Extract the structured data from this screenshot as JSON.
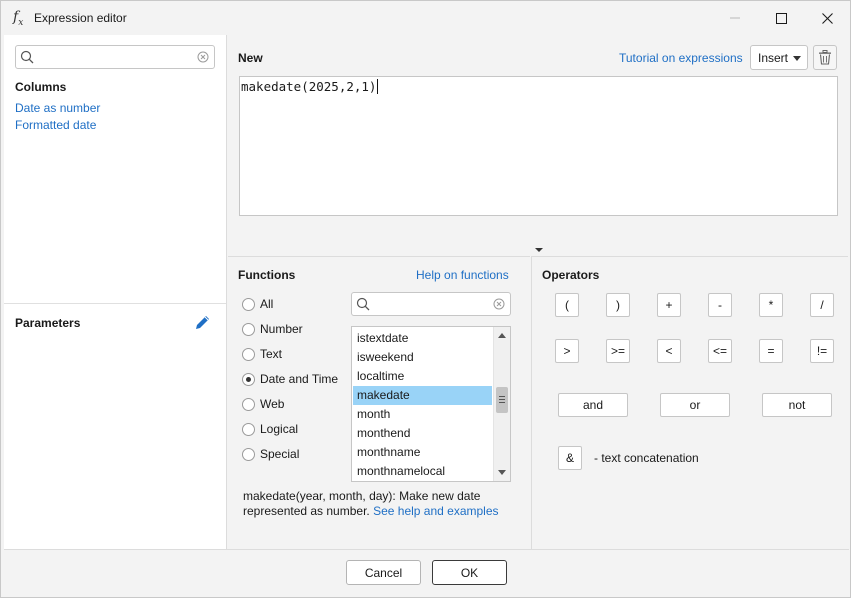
{
  "window": {
    "title": "Expression editor",
    "icon": "fx-function-icon"
  },
  "left": {
    "search": {
      "value": "",
      "placeholder": ""
    },
    "columns_heading": "Columns",
    "columns": [
      "Date as number",
      "Formatted date"
    ],
    "parameters_heading": "Parameters"
  },
  "editor": {
    "heading": "New",
    "tutorial_link": "Tutorial on expressions",
    "insert_label": "Insert",
    "expression": "makedate(2025,2,1)"
  },
  "functions": {
    "heading": "Functions",
    "help_link": "Help on functions",
    "search": {
      "value": "",
      "placeholder": ""
    },
    "categories": [
      "All",
      "Number",
      "Text",
      "Date and Time",
      "Web",
      "Logical",
      "Special"
    ],
    "selected_category": "Date and Time",
    "items": [
      "istextdate",
      "isweekend",
      "localtime",
      "makedate",
      "month",
      "monthend",
      "monthname",
      "monthnamelocal"
    ],
    "selected_item": "makedate",
    "description": "makedate(year, month, day): Make new date represented as number.",
    "description_link": "See help and examples"
  },
  "operators": {
    "heading": "Operators",
    "row1": [
      "(",
      ")",
      "+",
      "-",
      "*",
      "/"
    ],
    "row2": [
      ">",
      ">=",
      "<",
      "<=",
      "=",
      "!="
    ],
    "logical": [
      "and",
      "or",
      "not"
    ],
    "concat_symbol": "&",
    "concat_label": "- text concatenation"
  },
  "dialog": {
    "cancel_label": "Cancel",
    "ok_label": "OK"
  },
  "colors": {
    "link": "#1f6fc5",
    "selection": "#99d3f7",
    "edit_icon": "#1f6fc5"
  }
}
